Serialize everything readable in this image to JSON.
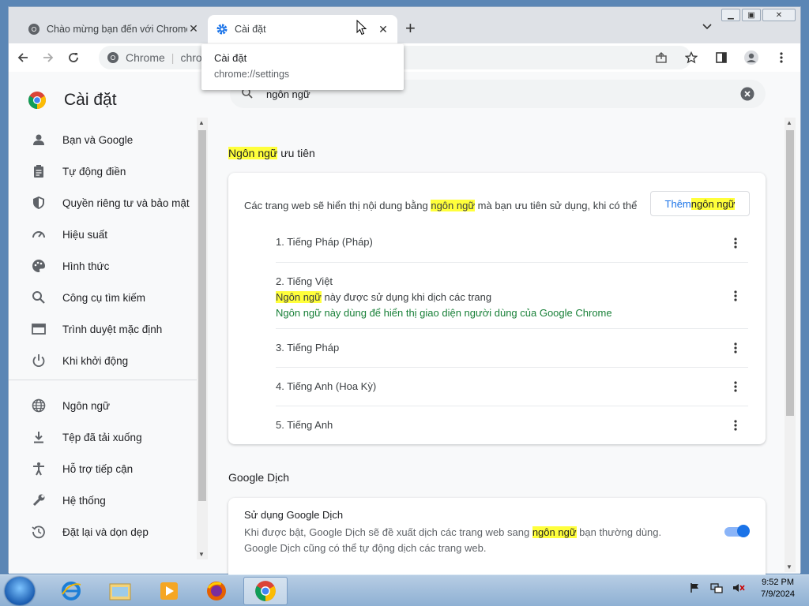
{
  "window": {
    "controls": [
      "minimize",
      "restore",
      "close"
    ]
  },
  "tabs": [
    {
      "title": "Chào mừng bạn đến với Chrome",
      "icon": "chrome-icon",
      "active": false
    },
    {
      "title": "Cài đặt",
      "icon": "settings-gear-icon",
      "active": true
    }
  ],
  "new_tab_label": "+",
  "omnibox": {
    "site_label": "Chrome",
    "text": "chrome://settings"
  },
  "hovercard": {
    "title": "Cài đặt",
    "url": "chrome://settings"
  },
  "settings": {
    "title": "Cài đặt",
    "search_query": "ngôn ngữ"
  },
  "sidebar": {
    "items": [
      {
        "label": "Bạn và Google",
        "icon": "person-icon"
      },
      {
        "label": "Tự động điền",
        "icon": "clipboard-icon"
      },
      {
        "label": "Quyền riêng tư và bảo mật",
        "icon": "shield-icon"
      },
      {
        "label": "Hiệu suất",
        "icon": "speedometer-icon"
      },
      {
        "label": "Hình thức",
        "icon": "palette-icon"
      },
      {
        "label": "Công cụ tìm kiếm",
        "icon": "search-icon"
      },
      {
        "label": "Trình duyệt mặc định",
        "icon": "browser-icon"
      },
      {
        "label": "Khi khởi động",
        "icon": "power-icon"
      },
      {
        "label": "Ngôn ngữ",
        "icon": "globe-icon"
      },
      {
        "label": "Tệp đã tải xuống",
        "icon": "download-icon"
      },
      {
        "label": "Hỗ trợ tiếp cận",
        "icon": "accessibility-icon"
      },
      {
        "label": "Hệ thống",
        "icon": "wrench-icon"
      },
      {
        "label": "Đặt lại và dọn dẹp",
        "icon": "history-icon"
      }
    ]
  },
  "languages_section": {
    "title_hl": "Ngôn ngữ",
    "title_rest": " ưu tiên",
    "desc_pre": "Các trang web sẽ hiển thị nội dung bằng ",
    "desc_hl": "ngôn ngữ",
    "desc_post": " mà bạn ưu tiên sử dụng, khi có thể",
    "add_pre": "Thêm ",
    "add_hl": "ngôn ngữ",
    "languages": [
      {
        "name": "1. Tiếng Pháp (Pháp)"
      },
      {
        "name": "2. Tiếng Việt",
        "note_hl": "Ngôn ngữ",
        "note_rest": " này được sử dụng khi dịch các trang",
        "note_green": "Ngôn ngữ này dùng để hiển thị giao diện người dùng của Google Chrome"
      },
      {
        "name": "3. Tiếng Pháp"
      },
      {
        "name": "4. Tiếng Anh (Hoa Kỳ)"
      },
      {
        "name": "5. Tiếng Anh"
      }
    ]
  },
  "translate_section": {
    "title": "Google Dịch",
    "setting_label": "Sử dụng Google Dịch",
    "desc_pre": "Khi được bật, Google Dịch sẽ đề xuất dịch các trang web sang ",
    "desc_hl": "ngôn ngữ",
    "desc_post": " bạn thường dùng. Google Dịch cũng có thể tự động dịch các trang web.",
    "enabled": true
  },
  "taskbar": {
    "items": [
      "internet-explorer-icon",
      "file-explorer-icon",
      "media-player-icon",
      "firefox-icon",
      "chrome-icon"
    ],
    "active_index": 4,
    "time": "9:52 PM",
    "date": "7/9/2024"
  },
  "colors": {
    "highlight": "#ffff3b",
    "accent": "#1a73e8",
    "green_text": "#188038"
  }
}
